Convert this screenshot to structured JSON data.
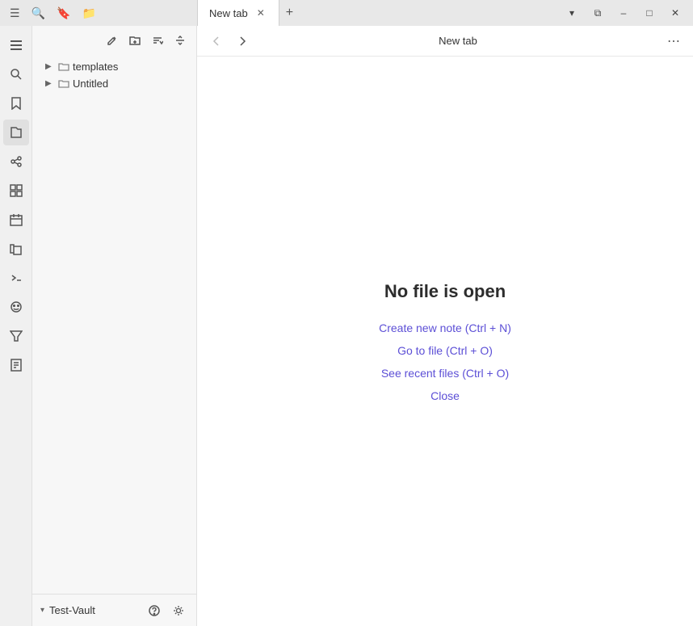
{
  "titlebar": {
    "tab_label": "New tab",
    "tab_title": "New tab",
    "new_tab_label": "+",
    "controls": {
      "dropdown_label": "▾",
      "split_label": "⧉",
      "minimize_label": "–",
      "maximize_label": "□",
      "close_label": "✕"
    }
  },
  "activity_bar": {
    "icons": [
      {
        "name": "sidebar-toggle-icon",
        "glyph": "☰"
      },
      {
        "name": "search-icon",
        "glyph": "🔍"
      },
      {
        "name": "bookmark-icon",
        "glyph": "🔖"
      },
      {
        "name": "folder-icon",
        "glyph": "📁"
      },
      {
        "name": "graph-icon",
        "glyph": "⬡"
      },
      {
        "name": "dashboard-icon",
        "glyph": "⊞"
      },
      {
        "name": "calendar-icon",
        "glyph": "📅"
      },
      {
        "name": "copy-icon",
        "glyph": "⧉"
      },
      {
        "name": "terminal-icon",
        "glyph": ">_"
      },
      {
        "name": "emoji-icon",
        "glyph": "😊"
      },
      {
        "name": "filter-icon",
        "glyph": "⛛"
      },
      {
        "name": "bookmark2-icon",
        "glyph": "📖"
      }
    ]
  },
  "sidebar": {
    "toolbar": {
      "new_note_btn": "✏",
      "new_folder_btn": "📁",
      "sort_btn": "⇅",
      "collapse_btn": "✕"
    },
    "tree": [
      {
        "id": "templates",
        "label": "templates",
        "type": "folder",
        "expanded": false
      },
      {
        "id": "untitled",
        "label": "Untitled",
        "type": "folder",
        "expanded": false
      }
    ],
    "footer": {
      "vault_name": "Test-Vault",
      "help_label": "?",
      "settings_label": "⚙"
    }
  },
  "editor": {
    "nav": {
      "back_label": "←",
      "forward_label": "→",
      "title": "New tab",
      "more_label": "⋯"
    },
    "empty_state": {
      "title": "No file is open",
      "actions": [
        {
          "id": "create-new-note",
          "label": "Create new note (Ctrl + N)"
        },
        {
          "id": "go-to-file",
          "label": "Go to file (Ctrl + O)"
        },
        {
          "id": "see-recent-files",
          "label": "See recent files (Ctrl + O)"
        },
        {
          "id": "close",
          "label": "Close"
        }
      ]
    }
  }
}
